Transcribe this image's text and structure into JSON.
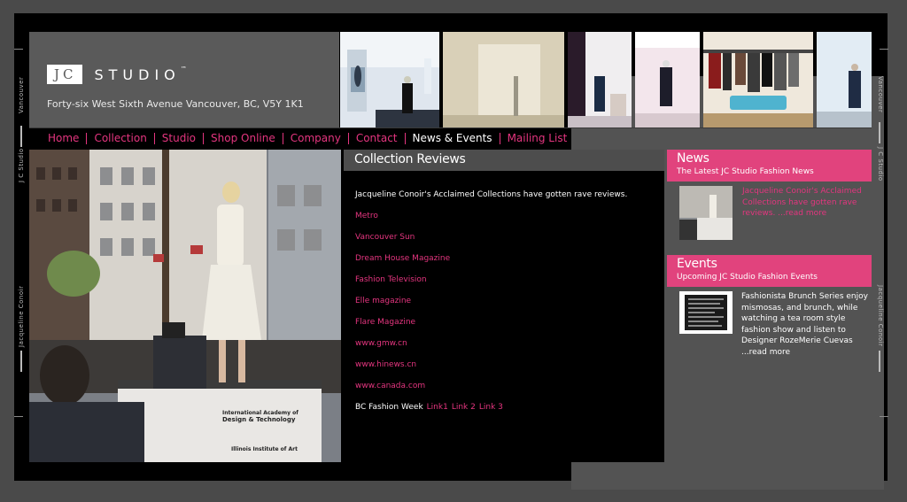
{
  "side_labels": {
    "left_top": "Vancouver",
    "left_mid": "J C Studio",
    "left_bottom": "Jacqueline Conoir",
    "right_top": "Vancouver",
    "right_mid": "J C Studio",
    "right_bottom": "Jacqueline Conoir"
  },
  "header": {
    "logo_jc": "JC",
    "logo_studio": "STUDIO",
    "trademark": "™",
    "address": "Forty-six West Sixth Avenue Vancouver, BC, V5Y 1K1"
  },
  "nav": {
    "items": [
      "Home",
      "Collection",
      "Studio",
      "Shop Online",
      "Company",
      "Contact",
      "News & Events",
      "Mailing List"
    ],
    "active": "News & Events"
  },
  "center": {
    "title": "Collection Reviews",
    "intro": "Jacqueline Conoir's Acclaimed Collections have gotten rave reviews.",
    "links": [
      "Metro",
      "Vancouver Sun",
      "Dream House Magazine",
      "Fashion Television",
      "Elle magazine",
      "Flare Magazine",
      "www.gmw.cn",
      "www.hinews.cn",
      "www.canada.com"
    ],
    "bc_fashion_week": "BC Fashion Week",
    "bc_links": [
      "Link1",
      "Link 2",
      "Link 3"
    ]
  },
  "news": {
    "title": "News",
    "subtitle": "The Latest JC Studio Fashion News",
    "text": "Jacqueline Conoir's Acclaimed Collections have gotten rave reviews. ...read more"
  },
  "events": {
    "title": "Events",
    "subtitle": "Upcoming JC Studio Fashion Events",
    "text": "Fashionista Brunch Series enjoy mismosas, and brunch, while watching a tea room style fashion show and listen to Designer RozeMerie Cuevas",
    "more": "...read more"
  },
  "billboard": {
    "line1": "International Academy of",
    "line2": "Design & Technology",
    "sub": "Illinois Institute of Art"
  },
  "colors": {
    "accent": "#e4357f",
    "header_gray": "#5a5a5a",
    "panel_gray": "#535353"
  }
}
